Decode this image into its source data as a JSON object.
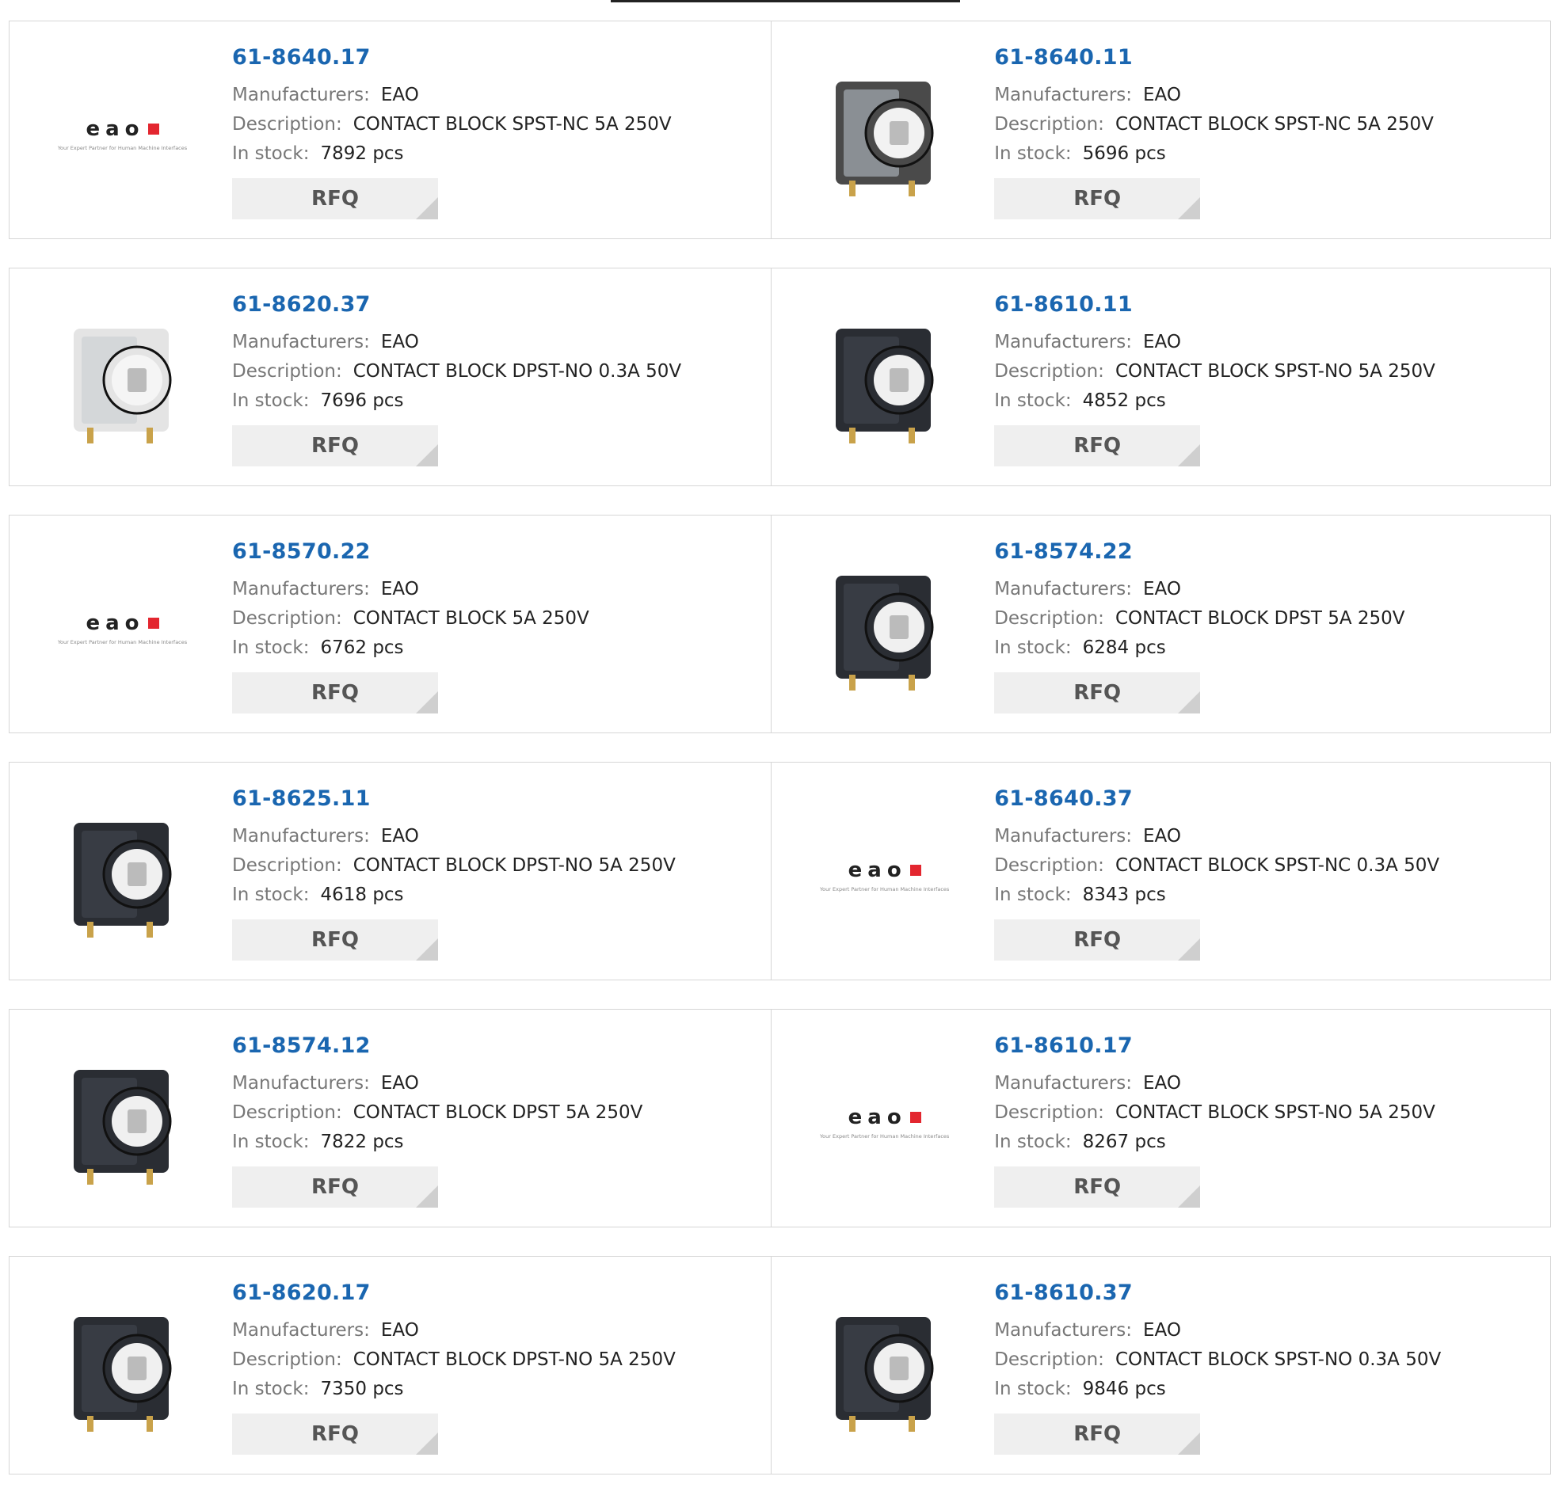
{
  "labels": {
    "manufacturers": "Manufacturers:",
    "description": "Description:",
    "in_stock": "In stock:",
    "rfq": "RFQ",
    "logo_word": "eao",
    "logo_tagline": "Your Expert Partner for Human Machine Interfaces"
  },
  "colors": {
    "part_link": "#1a66b0",
    "logo_accent": "#e3262f",
    "button_bg": "#efefef"
  },
  "products": [
    {
      "part": "61-8640.17",
      "manufacturer": "EAO",
      "description": "CONTACT BLOCK SPST-NC 5A 250V",
      "stock": "7892 pcs",
      "image": "eao-logo"
    },
    {
      "part": "61-8640.11",
      "manufacturer": "EAO",
      "description": "CONTACT BLOCK SPST-NC 5A 250V",
      "stock": "5696 pcs",
      "image": "contact-block-grey-photo"
    },
    {
      "part": "61-8620.37",
      "manufacturer": "EAO",
      "description": "CONTACT BLOCK DPST-NO 0.3A 50V",
      "stock": "7696 pcs",
      "image": "contact-block-white-photo"
    },
    {
      "part": "61-8610.11",
      "manufacturer": "EAO",
      "description": "CONTACT BLOCK SPST-NO 5A 250V",
      "stock": "4852 pcs",
      "image": "contact-block-black-photo"
    },
    {
      "part": "61-8570.22",
      "manufacturer": "EAO",
      "description": "CONTACT BLOCK 5A 250V",
      "stock": "6762 pcs",
      "image": "eao-logo"
    },
    {
      "part": "61-8574.22",
      "manufacturer": "EAO",
      "description": "CONTACT BLOCK DPST 5A 250V",
      "stock": "6284 pcs",
      "image": "contact-block-black-photo"
    },
    {
      "part": "61-8625.11",
      "manufacturer": "EAO",
      "description": "CONTACT BLOCK DPST-NO 5A 250V",
      "stock": "4618 pcs",
      "image": "contact-block-black-photo"
    },
    {
      "part": "61-8640.37",
      "manufacturer": "EAO",
      "description": "CONTACT BLOCK SPST-NC 0.3A 50V",
      "stock": "8343 pcs",
      "image": "eao-logo"
    },
    {
      "part": "61-8574.12",
      "manufacturer": "EAO",
      "description": "CONTACT BLOCK DPST 5A 250V",
      "stock": "7822 pcs",
      "image": "contact-block-black-photo"
    },
    {
      "part": "61-8610.17",
      "manufacturer": "EAO",
      "description": "CONTACT BLOCK SPST-NO 5A 250V",
      "stock": "8267 pcs",
      "image": "eao-logo"
    },
    {
      "part": "61-8620.17",
      "manufacturer": "EAO",
      "description": "CONTACT BLOCK DPST-NO 5A 250V",
      "stock": "7350 pcs",
      "image": "contact-block-black-photo"
    },
    {
      "part": "61-8610.37",
      "manufacturer": "EAO",
      "description": "CONTACT BLOCK SPST-NO 0.3A 50V",
      "stock": "9846 pcs",
      "image": "contact-block-black-photo"
    }
  ]
}
